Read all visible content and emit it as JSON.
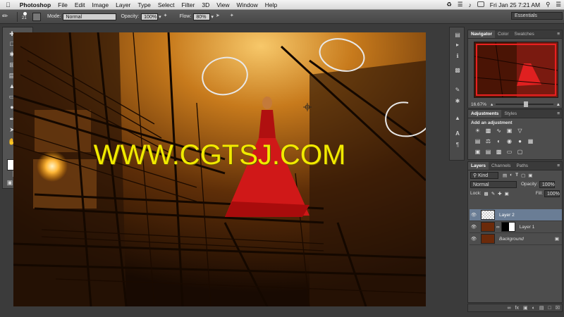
{
  "menubar": {
    "app_name": "Photoshop",
    "menus": [
      "File",
      "Edit",
      "Image",
      "Layer",
      "Type",
      "Select",
      "Filter",
      "3D",
      "View",
      "Window",
      "Help"
    ],
    "clock": "Fri Jan 25  7:21 AM"
  },
  "options_bar": {
    "brush_size": "21",
    "mode_label": "Mode:",
    "mode_value": "Normal",
    "opacity_label": "Opacity:",
    "opacity_value": "100%",
    "flow_label": "Flow:",
    "flow_value": "80%"
  },
  "workspace": "Essentials",
  "canvas": {
    "watermark": "WWW.CGTSJ.COM"
  },
  "navigator": {
    "tabs": [
      "Navigator",
      "Color",
      "Swatches"
    ],
    "zoom": "16.67%"
  },
  "adjustments": {
    "tabs": [
      "Adjustments",
      "Styles"
    ],
    "heading": "Add an adjustment"
  },
  "layers_panel": {
    "tabs": [
      "Layers",
      "Channels",
      "Paths"
    ],
    "kind_label": "Kind",
    "blend_mode": "Normal",
    "opacity_label": "Opacity:",
    "opacity_value": "100%",
    "lock_label": "Lock:",
    "fill_label": "Fill:",
    "fill_value": "100%",
    "layers": [
      {
        "name": "Layer 2"
      },
      {
        "name": "Layer 1"
      },
      {
        "name": "Background"
      }
    ]
  },
  "colors": {
    "watermark": "#f2ea00",
    "selection_circle": "#e8e8e8",
    "selected_layer": "#6a7d95"
  }
}
